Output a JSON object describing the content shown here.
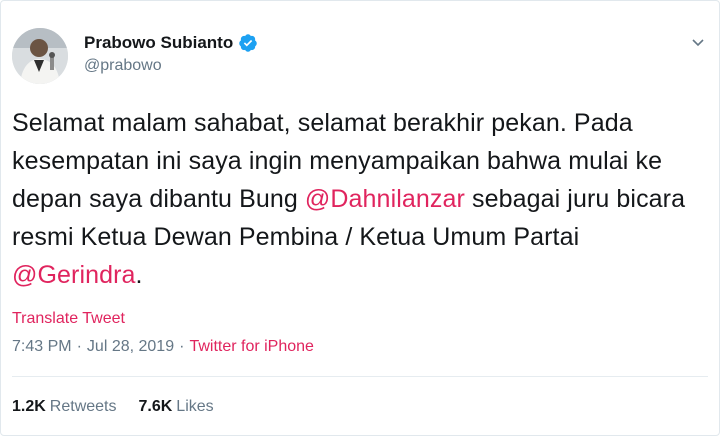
{
  "author": {
    "display_name": "Prabowo Subianto",
    "handle": "@prabowo"
  },
  "tweet": {
    "text_1": "Selamat malam sahabat, selamat berakhir pekan. Pada kesempatan ini saya ingin menyampaikan bahwa mulai ke depan saya dibantu Bung ",
    "mention_1": "@Dahnilanzar",
    "text_2": " sebagai juru bicara resmi Ketua Dewan Pembina / Ketua Umum Partai ",
    "mention_2": "@Gerindra",
    "text_3": "."
  },
  "translate_label": "Translate Tweet",
  "meta": {
    "time": "7:43 PM",
    "separator": "·",
    "date": "Jul 28, 2019",
    "source": "Twitter for iPhone"
  },
  "stats": {
    "retweets_count": "1.2K",
    "retweets_label": "Retweets",
    "likes_count": "7.6K",
    "likes_label": "Likes"
  },
  "colors": {
    "link": "#e0245e",
    "secondary": "#657786",
    "verified": "#1da1f2"
  },
  "icons": [
    "verified-badge-icon",
    "chevron-down-icon"
  ]
}
